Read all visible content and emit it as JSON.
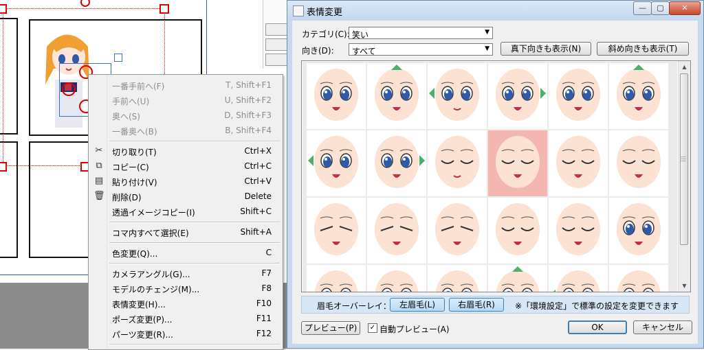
{
  "context_menu": {
    "items": [
      {
        "label": "一番手前へ(F)",
        "shortcut": "T, Shift+F1",
        "disabled": true
      },
      {
        "label": "手前へ(U)",
        "shortcut": "U, Shift+F2",
        "disabled": true
      },
      {
        "label": "奥へ(S)",
        "shortcut": "D, Shift+F3",
        "disabled": true
      },
      {
        "label": "一番奥へ(B)",
        "shortcut": "B, Shift+F4",
        "disabled": true
      },
      {
        "label": "切り取り(T)",
        "shortcut": "Ctrl+X",
        "icon": "scissors-icon"
      },
      {
        "label": "コピー(C)",
        "shortcut": "Ctrl+C",
        "icon": "copy-icon"
      },
      {
        "label": "貼り付け(V)",
        "shortcut": "Ctrl+V",
        "icon": "paste-icon"
      },
      {
        "label": "削除(D)",
        "shortcut": "Delete",
        "icon": "trash-icon"
      },
      {
        "label": "透過イメージコピー(I)",
        "shortcut": "Shift+C"
      },
      {
        "label": "コマ内すべて選択(E)",
        "shortcut": "Shift+A"
      },
      {
        "label": "色変更(Q)...",
        "shortcut": "C"
      },
      {
        "label": "カメラアングル(G)...",
        "shortcut": "F7"
      },
      {
        "label": "モデルのチェンジ(M)...",
        "shortcut": "F8"
      },
      {
        "label": "表情変更(H)...",
        "shortcut": "F10"
      },
      {
        "label": "ポーズ変更(P)...",
        "shortcut": "F11"
      },
      {
        "label": "パーツ変更(R)...",
        "shortcut": "F12"
      }
    ]
  },
  "dialog": {
    "title": "表情変更",
    "category_label": "カテゴリ(C):",
    "category_value": "笑い",
    "direction_label": "向き(D):",
    "direction_value": "すべて",
    "btn_straight_down": "真下向きも表示(N)",
    "btn_diagonal": "斜め向きも表示(T)",
    "brow_overlay_label": "眉毛オーバーレイ：",
    "btn_left_brow": "左眉毛(L)",
    "btn_right_brow": "右眉毛(R)",
    "brow_note": "※「環境設定」で標準の設定を変更できます",
    "btn_preview": "プレビュー(P)",
    "auto_preview_label": "自動プレビュー(A)",
    "auto_preview_checked": true,
    "btn_ok": "OK",
    "btn_cancel": "キャンセル",
    "window_controls": {
      "minimize": "—",
      "maximize": "▢",
      "close": "✕"
    }
  },
  "face_grid": {
    "rows": [
      [
        {
          "eyes": "open",
          "mouth": "open",
          "arrow": ""
        },
        {
          "eyes": "open",
          "mouth": "open",
          "arrow": "top"
        },
        {
          "eyes": "open",
          "mouth": "smile",
          "arrow": "left"
        },
        {
          "eyes": "open",
          "mouth": "open",
          "arrow": "right"
        },
        {
          "eyes": "open",
          "mouth": "open",
          "arrow": ""
        },
        {
          "eyes": "open",
          "mouth": "open",
          "arrow": "top"
        }
      ],
      [
        {
          "eyes": "open",
          "mouth": "open",
          "arrow": "left"
        },
        {
          "eyes": "open",
          "mouth": "open",
          "arrow": "right"
        },
        {
          "eyes": "closed",
          "mouth": "smile",
          "arrow": ""
        },
        {
          "eyes": "closed",
          "mouth": "open",
          "arrow": "",
          "selected": true
        },
        {
          "eyes": "closed",
          "mouth": "open",
          "arrow": ""
        },
        {
          "eyes": "closed",
          "mouth": "open",
          "arrow": ""
        }
      ],
      [
        {
          "eyes": "squint",
          "mouth": "open",
          "arrow": ""
        },
        {
          "eyes": "squint",
          "mouth": "open",
          "arrow": ""
        },
        {
          "eyes": "squint",
          "mouth": "open",
          "arrow": ""
        },
        {
          "eyes": "closed",
          "mouth": "open",
          "arrow": ""
        },
        {
          "eyes": "closed",
          "mouth": "open",
          "arrow": ""
        },
        {
          "eyes": "open",
          "mouth": "open",
          "arrow": ""
        }
      ],
      [
        {
          "eyes": "open",
          "mouth": "open",
          "arrow": ""
        },
        {
          "eyes": "open",
          "mouth": "open",
          "arrow": ""
        },
        {
          "eyes": "open",
          "mouth": "open",
          "arrow": ""
        },
        {
          "eyes": "open",
          "mouth": "open",
          "arrow": "top"
        },
        {
          "eyes": "open",
          "mouth": "open",
          "arrow": "left"
        },
        {
          "eyes": "open",
          "mouth": "open",
          "arrow": ""
        }
      ]
    ]
  },
  "colors": {
    "selected_cell": "#f4b6b1",
    "face_skin": "#fbe2d3",
    "iris": "#2f5aa8",
    "mouth": "#c0304a",
    "arrow": "#4caf6a"
  }
}
